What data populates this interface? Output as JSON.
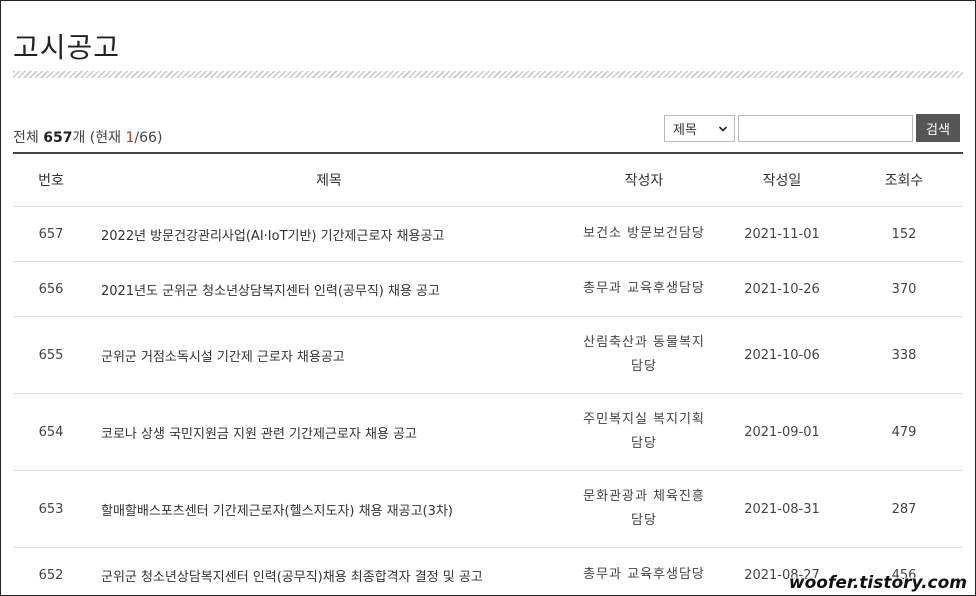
{
  "page": {
    "title": "고시공고"
  },
  "summary": {
    "total_label": "전체",
    "total_count": "657",
    "total_unit": "개",
    "current_prefix": "(현재",
    "current_page": "1",
    "page_total": "/66)"
  },
  "search": {
    "field_selected": "제목",
    "query_value": "",
    "button_label": "검색"
  },
  "table": {
    "headers": {
      "num": "번호",
      "title": "제목",
      "author": "작성자",
      "date": "작성일",
      "views": "조회수"
    },
    "rows": [
      {
        "num": "657",
        "title": "2022년 방문건강관리사업(AI·IoT기반) 기간제근로자 채용공고",
        "author_l1": "보건소 방문보건담당",
        "author_l2": "",
        "date": "2021-11-01",
        "views": "152"
      },
      {
        "num": "656",
        "title": "2021년도 군위군 청소년상담복지센터 인력(공무직) 채용 공고",
        "author_l1": "총무과 교육후생담당",
        "author_l2": "",
        "date": "2021-10-26",
        "views": "370"
      },
      {
        "num": "655",
        "title": "군위군 거점소독시설 기간제 근로자 채용공고",
        "author_l1": "산림축산과 동물복지",
        "author_l2": "담당",
        "date": "2021-10-06",
        "views": "338"
      },
      {
        "num": "654",
        "title": "코로나 상생 국민지원금 지원 관련 기간제근로자 채용 공고",
        "author_l1": "주민복지실 복지기획",
        "author_l2": "담당",
        "date": "2021-09-01",
        "views": "479"
      },
      {
        "num": "653",
        "title": "할매할배스포츠센터 기간제근로자(헬스지도자) 채용 재공고(3차)",
        "author_l1": "문화관광과 체육진흥",
        "author_l2": "담당",
        "date": "2021-08-31",
        "views": "287"
      },
      {
        "num": "652",
        "title": "군위군 청소년상담복지센터 인력(공무직)채용 최종합격자 결정 및 공고",
        "author_l1": "총무과 교육후생담당",
        "author_l2": "",
        "date": "2021-08-27",
        "views": "456"
      }
    ]
  },
  "watermark": "woofer.tistory.com"
}
